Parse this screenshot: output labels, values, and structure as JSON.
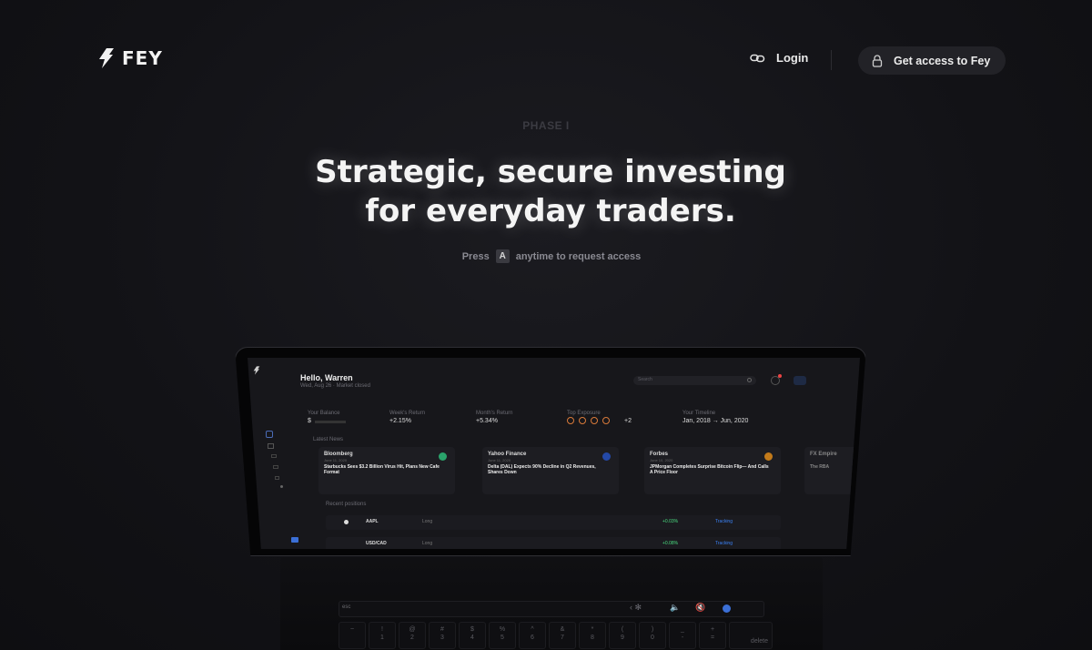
{
  "header": {
    "brand": "FEY",
    "login_label": "Login",
    "access_label": "Get access to Fey"
  },
  "hero": {
    "phase": "PHASE I",
    "headline_line1": "Strategic, secure investing",
    "headline_line2": "for everyday traders.",
    "press_prefix": "Press",
    "press_key": "A",
    "press_suffix": "anytime to request access"
  },
  "dashboard": {
    "greeting": "Hello, Warren",
    "subtitle": "Wed, Aug 26 · Market closed",
    "search_placeholder": "Search",
    "stats": [
      {
        "label": "Your Balance",
        "value": "$"
      },
      {
        "label": "Week's Return",
        "value": "+2.15%"
      },
      {
        "label": "Month's Return",
        "value": "+5.34%"
      },
      {
        "label": "Top Exposure",
        "value": "+2"
      },
      {
        "label": "Your Timeline",
        "value": "Jan, 2018 → Jun, 2020"
      }
    ],
    "latest_news_label": "Latest News",
    "news": [
      {
        "source": "Bloomberg",
        "date": "June 11, 2020",
        "headline": "Starbucks Sees $3.2 Billion Virus Hit, Plans New Cafe Format"
      },
      {
        "source": "Yahoo Finance",
        "date": "June 11, 2020",
        "headline": "Delta (DAL) Expects 90% Decline in Q2 Revenues, Shares Down"
      },
      {
        "source": "Forbes",
        "date": "June 10, 2020",
        "headline": "JPMorgan Completes Surprise Bitcoin Flip— And Calls A Price Floor"
      },
      {
        "source": "FX Empire",
        "date": "",
        "headline": "The RBA"
      }
    ],
    "recent_positions_label": "Recent positions",
    "positions": [
      {
        "symbol": "AAPL",
        "side": "Long",
        "status": "Tracking",
        "change": "+0.03%"
      },
      {
        "symbol": "USD/CAD",
        "side": "Long",
        "status": "Tracking",
        "change": "+0.08%"
      }
    ]
  },
  "keyboard": {
    "esc": "esc",
    "keys": [
      "~",
      "!\n1",
      "@\n2",
      "#\n3",
      "$\n4",
      "%\n5",
      "^\n6",
      "&\n7",
      "*\n8",
      "(\n9",
      ")\n0",
      "_\n-",
      "+\n="
    ],
    "delete": "delete"
  },
  "colors": {
    "background": "#121216",
    "accent_blue": "#3b82f6",
    "positive_green": "#4ade80",
    "muted_text": "#8a8a92"
  }
}
